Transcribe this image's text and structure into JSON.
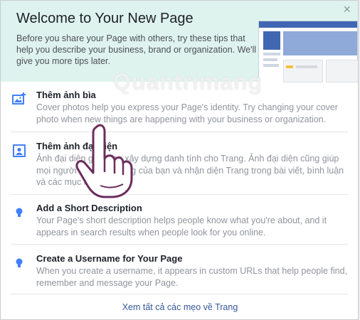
{
  "dialog": {
    "title": "Welcome to Your New Page",
    "close_icon": "×",
    "intro": "Before you share your Page with others, try these tips that help you describe your business, brand or organization. We'll give you more tips later."
  },
  "tips": [
    {
      "icon": "photo-icon",
      "title": "Thêm ảnh bìa",
      "desc": "Cover photos help you express your Page's identity. Try changing your cover photo when new things are happening with your business or organization."
    },
    {
      "icon": "profile-picture-icon",
      "title": "Thêm ảnh đại diện",
      "desc": "Ảnh đại diện giúp bạn xây dựng danh tính cho Trang. Ảnh đại diện cũng giúp mọi người tìm thấy Trang của bạn và nhận diện Trang trong bài viết, bình luận và các mục khác."
    },
    {
      "icon": "lightbulb-icon",
      "title": "Add a Short Description",
      "desc": "Your Page's short description helps people know what you're about, and it appears in search results when people look for you online."
    },
    {
      "icon": "lightbulb-icon",
      "title": "Create a Username for Your Page",
      "desc": "When you create a username, it appears in custom URLs that help people find, remember and message your Page."
    }
  ],
  "footer": {
    "see_all": "Xem tất cả các mẹo về Trang"
  },
  "watermark": {
    "text": "Quantrimang"
  },
  "colors": {
    "header_bg": "#dff3ee",
    "icon_blue": "#4080ff",
    "link": "#365899"
  }
}
